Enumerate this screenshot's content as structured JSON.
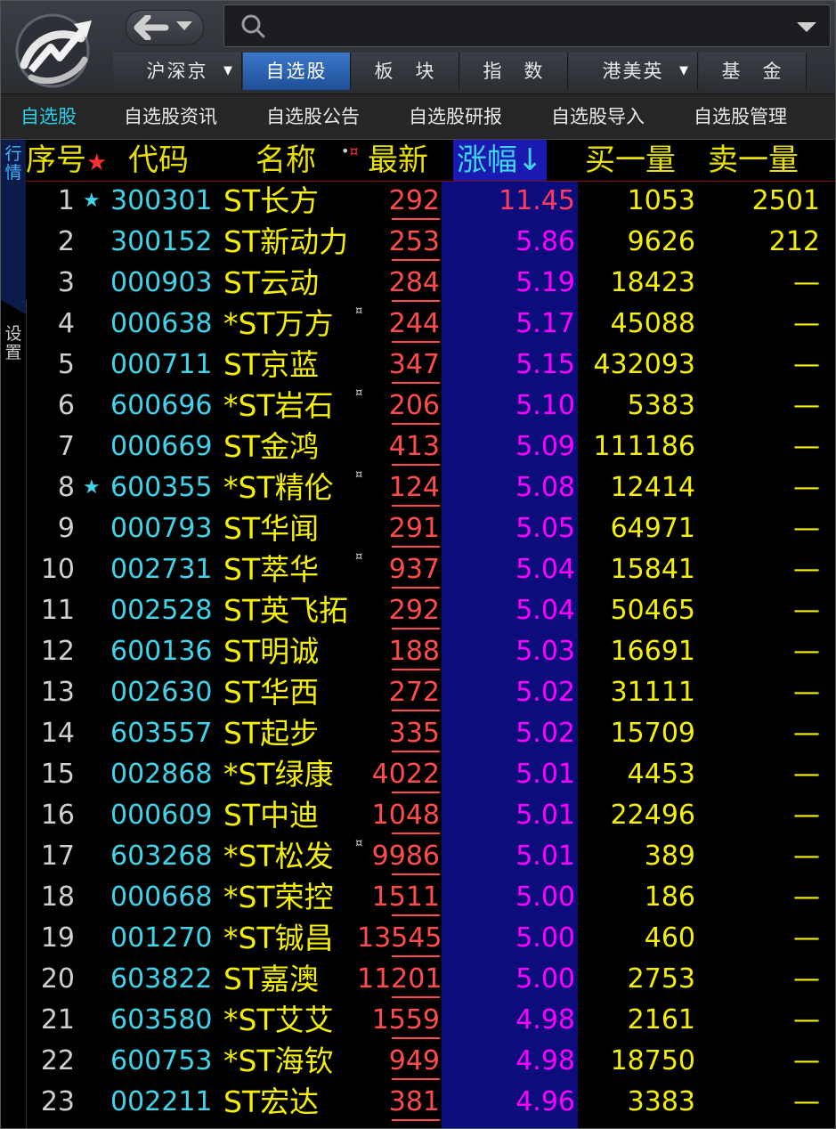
{
  "header": {
    "nav_tabs": [
      {
        "label": "沪深京",
        "dropdown": true
      },
      {
        "label": "自选股",
        "dropdown": false
      },
      {
        "label": "板　块",
        "dropdown": false
      },
      {
        "label": "指　数",
        "dropdown": false
      },
      {
        "label": "港美英",
        "dropdown": true
      },
      {
        "label": "基　金",
        "dropdown": false
      }
    ],
    "search_placeholder": ""
  },
  "subnav": [
    "自选股",
    "自选股资讯",
    "自选股公告",
    "自选股研报",
    "自选股导入",
    "自选股管理"
  ],
  "side_tabs": {
    "quotes": "行情",
    "settings": "设置"
  },
  "columns": {
    "index": "序号",
    "code": "代码",
    "name": "名称",
    "last": "最新",
    "change": "涨幅↓",
    "bid_volume": "买一量",
    "ask_volume": "卖一量"
  },
  "rows": [
    {
      "no": "1",
      "fav": true,
      "code": "300301",
      "name": "ST长方",
      "mark": false,
      "last": "292",
      "chg": "11.45",
      "buy": "1053",
      "sell": "2501"
    },
    {
      "no": "2",
      "fav": false,
      "code": "300152",
      "name": "ST新动力",
      "mark": false,
      "last": "253",
      "chg": "5.86",
      "buy": "9626",
      "sell": "212"
    },
    {
      "no": "3",
      "fav": false,
      "code": "000903",
      "name": "ST云动",
      "mark": false,
      "last": "284",
      "chg": "5.19",
      "buy": "18423",
      "sell": "—"
    },
    {
      "no": "4",
      "fav": false,
      "code": "000638",
      "name": "*ST万方",
      "mark": true,
      "last": "244",
      "chg": "5.17",
      "buy": "45088",
      "sell": "—"
    },
    {
      "no": "5",
      "fav": false,
      "code": "000711",
      "name": "ST京蓝",
      "mark": false,
      "last": "347",
      "chg": "5.15",
      "buy": "432093",
      "sell": "—"
    },
    {
      "no": "6",
      "fav": false,
      "code": "600696",
      "name": "*ST岩石",
      "mark": true,
      "last": "206",
      "chg": "5.10",
      "buy": "5383",
      "sell": "—"
    },
    {
      "no": "7",
      "fav": false,
      "code": "000669",
      "name": "ST金鸿",
      "mark": false,
      "last": "413",
      "chg": "5.09",
      "buy": "111186",
      "sell": "—"
    },
    {
      "no": "8",
      "fav": true,
      "code": "600355",
      "name": "*ST精伦",
      "mark": true,
      "last": "124",
      "chg": "5.08",
      "buy": "12414",
      "sell": "—"
    },
    {
      "no": "9",
      "fav": false,
      "code": "000793",
      "name": "ST华闻",
      "mark": false,
      "last": "291",
      "chg": "5.05",
      "buy": "64971",
      "sell": "—"
    },
    {
      "no": "10",
      "fav": false,
      "code": "002731",
      "name": "ST萃华",
      "mark": true,
      "last": "937",
      "chg": "5.04",
      "buy": "15841",
      "sell": "—"
    },
    {
      "no": "11",
      "fav": false,
      "code": "002528",
      "name": "ST英飞拓",
      "mark": false,
      "last": "292",
      "chg": "5.04",
      "buy": "50465",
      "sell": "—"
    },
    {
      "no": "12",
      "fav": false,
      "code": "600136",
      "name": "ST明诚",
      "mark": false,
      "last": "188",
      "chg": "5.03",
      "buy": "16691",
      "sell": "—"
    },
    {
      "no": "13",
      "fav": false,
      "code": "002630",
      "name": "ST华西",
      "mark": false,
      "last": "272",
      "chg": "5.02",
      "buy": "31111",
      "sell": "—"
    },
    {
      "no": "14",
      "fav": false,
      "code": "603557",
      "name": "ST起步",
      "mark": false,
      "last": "335",
      "chg": "5.02",
      "buy": "15709",
      "sell": "—"
    },
    {
      "no": "15",
      "fav": false,
      "code": "002868",
      "name": "*ST绿康",
      "mark": false,
      "last": "4022",
      "chg": "5.01",
      "buy": "4453",
      "sell": "—"
    },
    {
      "no": "16",
      "fav": false,
      "code": "000609",
      "name": "ST中迪",
      "mark": false,
      "last": "1048",
      "chg": "5.01",
      "buy": "22496",
      "sell": "—"
    },
    {
      "no": "17",
      "fav": false,
      "code": "603268",
      "name": "*ST松发",
      "mark": true,
      "last": "9986",
      "chg": "5.01",
      "buy": "389",
      "sell": "—"
    },
    {
      "no": "18",
      "fav": false,
      "code": "000668",
      "name": "*ST荣控",
      "mark": false,
      "last": "1511",
      "chg": "5.00",
      "buy": "186",
      "sell": "—"
    },
    {
      "no": "19",
      "fav": false,
      "code": "001270",
      "name": "*ST铖昌",
      "mark": false,
      "last": "13545",
      "chg": "5.00",
      "buy": "460",
      "sell": "—"
    },
    {
      "no": "20",
      "fav": false,
      "code": "603822",
      "name": "ST嘉澳",
      "mark": false,
      "last": "11201",
      "chg": "5.00",
      "buy": "2753",
      "sell": "—"
    },
    {
      "no": "21",
      "fav": false,
      "code": "603580",
      "name": "*ST艾艾",
      "mark": false,
      "last": "1559",
      "chg": "4.98",
      "buy": "2161",
      "sell": "—"
    },
    {
      "no": "22",
      "fav": false,
      "code": "600753",
      "name": "*ST海钦",
      "mark": false,
      "last": "949",
      "chg": "4.98",
      "buy": "18750",
      "sell": "—"
    },
    {
      "no": "23",
      "fav": false,
      "code": "002211",
      "name": "ST宏达",
      "mark": false,
      "last": "381",
      "chg": "4.96",
      "buy": "3383",
      "sell": "—"
    }
  ]
}
